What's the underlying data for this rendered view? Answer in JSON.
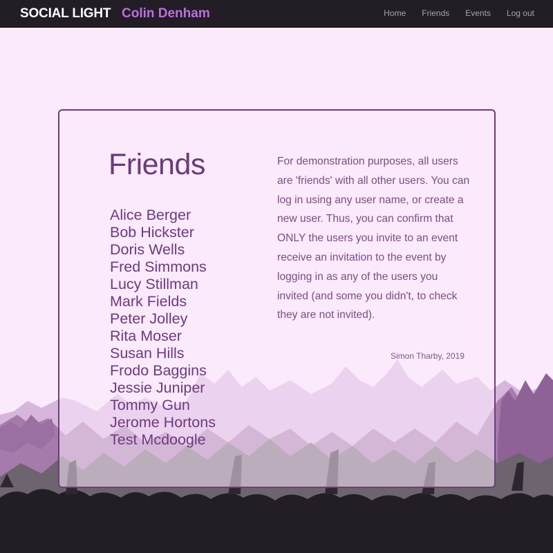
{
  "navbar": {
    "brand": "SOCIAL LIGHT",
    "username": "Colin Denham",
    "links": [
      "Home",
      "Friends",
      "Events",
      "Log out"
    ]
  },
  "main": {
    "title": "Friends",
    "friends": [
      "Alice Berger",
      "Bob Hickster",
      "Doris Wells",
      "Fred Simmons",
      "Lucy Stillman",
      "Mark Fields",
      "Peter Jolley",
      "Rita Moser",
      "Susan Hills",
      "Frodo Baggins",
      "Jessie Juniper",
      "Tommy Gun",
      "Jerome Hortons",
      "Test Mcdoogle"
    ],
    "info": "For demonstration purposes, all users are 'friends' with all other users. You can log in using any user name, or create a new user. Thus, you can confirm that ONLY the users you invite to an event receive an invitation to the event by logging in as any of the users you invited (and some you didn't, to check they are not invited).",
    "credit": "Simon Tharby, 2019"
  },
  "colors": {
    "navbar_bg": "#231d25",
    "page_bg": "#fbe9fc",
    "accent": "#bc6fe0",
    "text_purple": "#6b3a78"
  }
}
